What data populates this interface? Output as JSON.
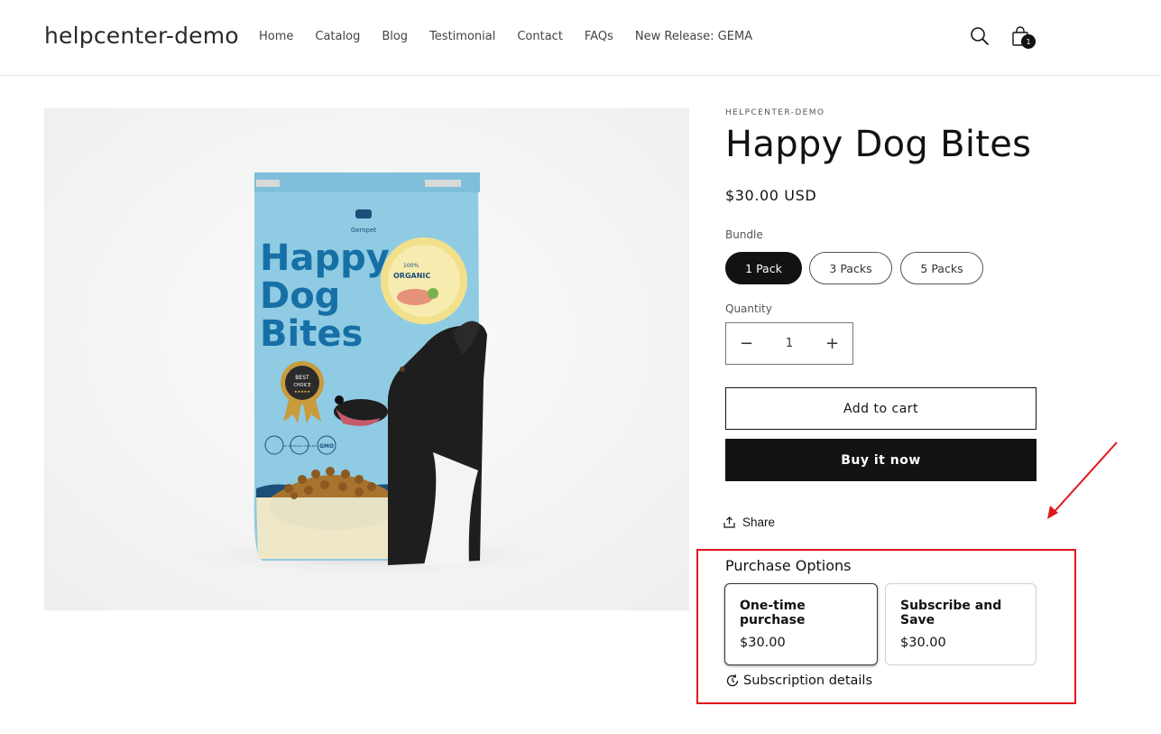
{
  "header": {
    "logo": "helpcenter-demo",
    "nav": [
      "Home",
      "Catalog",
      "Blog",
      "Testimonial",
      "Contact",
      "FAQs",
      "New Release: GEMA"
    ],
    "cart_count": "1"
  },
  "product": {
    "vendor": "HELPCENTER-DEMO",
    "title": "Happy Dog Bites",
    "price": "$30.00 USD",
    "image": {
      "brand": "Gempet",
      "package_title": [
        "Happy",
        "Dog",
        "Bites"
      ],
      "seal_top": "100%",
      "seal_main": "ORGANIC",
      "badge_line1": "BEST",
      "badge_line2": "CHOICE",
      "badge_stars": "★★★★★",
      "cert_icons": [
        "NO ARTIFICIAL COLOURS",
        "GMO"
      ]
    },
    "bundle": {
      "label": "Bundle",
      "options": [
        "1 Pack",
        "3 Packs",
        "5 Packs"
      ],
      "selected": "1 Pack"
    },
    "quantity": {
      "label": "Quantity",
      "value": "1",
      "minus": "−",
      "plus": "+"
    },
    "add_to_cart": "Add to cart",
    "buy_now": "Buy it now",
    "share": "Share"
  },
  "purchase_options": {
    "title": "Purchase Options",
    "options": [
      {
        "name": "One-time purchase",
        "price": "$30.00",
        "selected": true
      },
      {
        "name": "Subscribe and Save",
        "price": "$30.00",
        "selected": false
      }
    ],
    "details_link": "Subscription details"
  },
  "colors": {
    "accent": "#121212",
    "annotation": "#e0161c",
    "package_blue": "#8fcbe3",
    "package_text": "#1670a6"
  }
}
